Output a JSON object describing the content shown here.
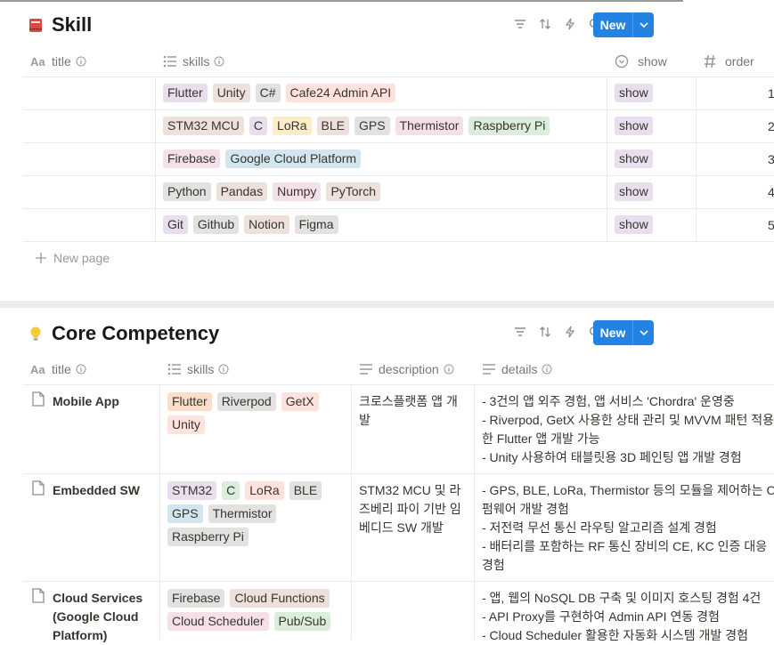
{
  "colors": {
    "purple": "#e8deee",
    "brown": "#eee0da",
    "gray": "#e3e2e0",
    "red": "#ffe2dd",
    "orange": "#fadec9",
    "yellow": "#fdecc8",
    "green": "#dbeddb",
    "blue": "#d3e5ef",
    "pink": "#f5e0e9",
    "accent": "#2383e2"
  },
  "skill_db": {
    "title": "Skill",
    "icon": "red-book-icon",
    "new_label": "New",
    "columns": {
      "title": "title",
      "skills": "skills",
      "show": "show",
      "order": "order"
    },
    "rows": [
      {
        "title": "",
        "skills": [
          {
            "name": "Flutter",
            "color": "purple"
          },
          {
            "name": "Unity",
            "color": "brown"
          },
          {
            "name": "C#",
            "color": "gray"
          },
          {
            "name": "Cafe24 Admin API",
            "color": "red"
          }
        ],
        "show": "show",
        "order": "1"
      },
      {
        "title": "",
        "skills": [
          {
            "name": "STM32 MCU",
            "color": "brown"
          },
          {
            "name": "C",
            "color": "purple"
          },
          {
            "name": "LoRa",
            "color": "yellow"
          },
          {
            "name": "BLE",
            "color": "brown"
          },
          {
            "name": "GPS",
            "color": "gray"
          },
          {
            "name": "Thermistor",
            "color": "pink"
          },
          {
            "name": "Raspberry Pi",
            "color": "green"
          }
        ],
        "show": "show",
        "order": "2"
      },
      {
        "title": "",
        "skills": [
          {
            "name": "Firebase",
            "color": "pink"
          },
          {
            "name": "Google Cloud Platform",
            "color": "blue"
          }
        ],
        "show": "show",
        "order": "3"
      },
      {
        "title": "",
        "skills": [
          {
            "name": "Python",
            "color": "gray"
          },
          {
            "name": "Pandas",
            "color": "brown"
          },
          {
            "name": "Numpy",
            "color": "pink"
          },
          {
            "name": "PyTorch",
            "color": "brown"
          }
        ],
        "show": "show",
        "order": "4"
      },
      {
        "title": "",
        "skills": [
          {
            "name": "Git",
            "color": "purple"
          },
          {
            "name": "Github",
            "color": "gray"
          },
          {
            "name": "Notion",
            "color": "brown"
          },
          {
            "name": "Figma",
            "color": "gray"
          }
        ],
        "show": "show",
        "order": "5"
      }
    ],
    "new_page_label": "New page"
  },
  "core_db": {
    "title": "Core Competency",
    "icon": "lightbulb-icon",
    "new_label": "New",
    "columns": {
      "title": "title",
      "skills": "skills",
      "description": "description",
      "details": "details"
    },
    "rows": [
      {
        "title": [
          "Mobile App"
        ],
        "skills": [
          [
            {
              "name": "Flutter",
              "color": "orange"
            },
            {
              "name": "Riverpod",
              "color": "gray"
            },
            {
              "name": "GetX",
              "color": "red"
            }
          ],
          [
            {
              "name": "Unity",
              "color": "red"
            }
          ]
        ],
        "description": [
          "크로스플랫폼 앱 개",
          "발"
        ],
        "details": [
          "- 3건의 앱 외주 경험, 앱 서비스 'Chordra' 운영중",
          "- Riverpod, GetX 사용한 상태 관리 및 MVVM 패턴 적용",
          "한 Flutter 앱 개발 가능",
          "- Unity 사용하여 태블릿용 3D 페인팅 앱 개발 경험"
        ]
      },
      {
        "title": [
          "Embedded SW"
        ],
        "skills": [
          [
            {
              "name": "STM32",
              "color": "purple"
            },
            {
              "name": "C",
              "color": "green"
            },
            {
              "name": "LoRa",
              "color": "red"
            },
            {
              "name": "BLE",
              "color": "gray"
            }
          ],
          [
            {
              "name": "GPS",
              "color": "blue"
            },
            {
              "name": "Thermistor",
              "color": "gray"
            }
          ],
          [
            {
              "name": "Raspberry Pi",
              "color": "gray"
            }
          ]
        ],
        "description": [
          "STM32 MCU 및 라",
          "즈베리 파이 기반 임",
          "베디드 SW 개발"
        ],
        "details": [
          "- GPS, BLE, LoRa, Thermistor 등의 모듈을 제어하는 C",
          "펌웨어 개발 경험",
          "- 저전력 무선 통신 라우팅 알고리즘 설계 경험",
          "- 배터리를 포함하는 RF 통신 장비의 CE, KC 인증 대응",
          "경험"
        ]
      },
      {
        "title": [
          "Cloud Services",
          "(Google Cloud",
          "Platform)"
        ],
        "skills": [
          [
            {
              "name": "Firebase",
              "color": "gray"
            },
            {
              "name": "Cloud Functions",
              "color": "brown"
            }
          ],
          [
            {
              "name": "Cloud Scheduler",
              "color": "pink"
            },
            {
              "name": "Pub/Sub",
              "color": "green"
            }
          ]
        ],
        "description": [],
        "details": [
          "- 앱, 웹의 NoSQL DB 구축 및 이미지 호스팅 경험 4건",
          "- API Proxy를 구현하여 Admin API 연동 경험",
          "- Cloud Scheduler 활용한 자동화 시스템 개발 경험"
        ]
      }
    ]
  }
}
